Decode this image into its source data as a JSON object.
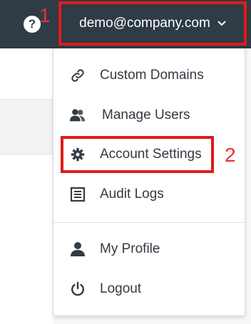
{
  "header": {
    "help_icon": "question-circle-icon",
    "user_email": "demo@company.com",
    "annotation_1": "1"
  },
  "menu": {
    "items": [
      {
        "label": "Custom Domains",
        "icon": "link-icon"
      },
      {
        "label": "Manage Users",
        "icon": "users-icon"
      },
      {
        "label": "Account Settings",
        "icon": "gear-icon"
      },
      {
        "label": "Audit Logs",
        "icon": "list-icon"
      }
    ],
    "footer_items": [
      {
        "label": "My Profile",
        "icon": "user-icon"
      },
      {
        "label": "Logout",
        "icon": "power-icon"
      }
    ],
    "annotation_2": "2"
  },
  "colors": {
    "topbar": "#2f3b45",
    "highlight": "#e01b1b",
    "text": "#333b44"
  }
}
